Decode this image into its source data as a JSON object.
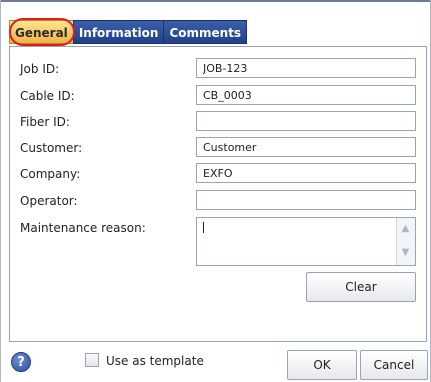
{
  "tabs": [
    {
      "label": "General"
    },
    {
      "label": "Information"
    },
    {
      "label": "Comments"
    }
  ],
  "form": {
    "job_id": {
      "label": "Job ID:",
      "value": "JOB-123"
    },
    "cable_id": {
      "label": "Cable ID:",
      "value": "CB_0003"
    },
    "fiber_id": {
      "label": "Fiber ID:",
      "value": ""
    },
    "customer": {
      "label": "Customer:",
      "value": "Customer"
    },
    "company": {
      "label": "Company:",
      "value": "EXFO"
    },
    "operator": {
      "label": "Operator:",
      "value": ""
    },
    "maintenance_reason": {
      "label": "Maintenance reason:",
      "value": ""
    }
  },
  "buttons": {
    "clear": "Clear",
    "ok": "OK",
    "cancel": "Cancel",
    "help": "?"
  },
  "template": {
    "label": "Use as template",
    "checked": false
  },
  "colors": {
    "active_tab": "#f2b347",
    "tab": "#22408a",
    "highlight": "#e01b22"
  }
}
